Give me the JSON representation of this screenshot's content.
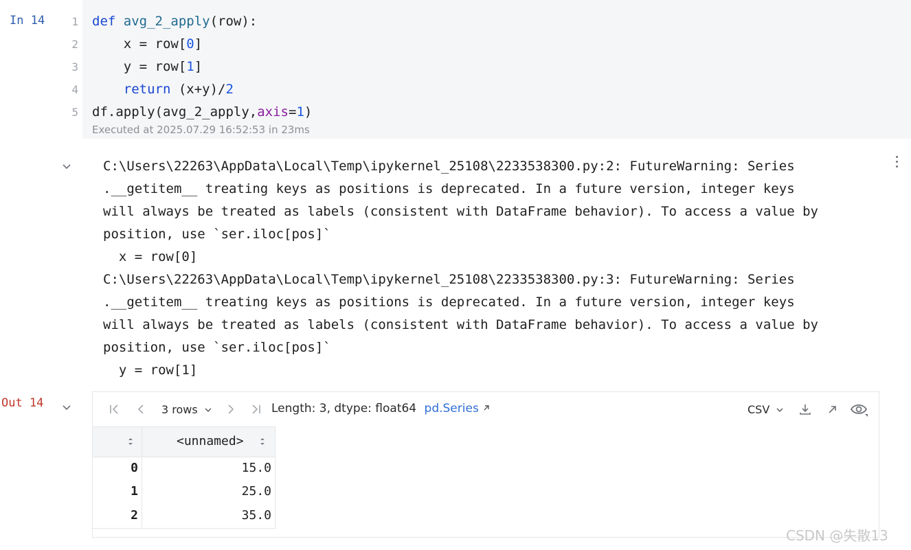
{
  "input_cell": {
    "prompt": "In 14",
    "line_numbers": [
      "1",
      "2",
      "3",
      "4",
      "5"
    ],
    "lines": [
      [
        {
          "t": "def ",
          "c": "kw"
        },
        {
          "t": "avg_2_apply",
          "c": "fn"
        },
        {
          "t": "(row):",
          "c": ""
        }
      ],
      [
        {
          "t": "    x = row[",
          "c": ""
        },
        {
          "t": "0",
          "c": "num"
        },
        {
          "t": "]",
          "c": ""
        }
      ],
      [
        {
          "t": "    y = row[",
          "c": ""
        },
        {
          "t": "1",
          "c": "num"
        },
        {
          "t": "]",
          "c": ""
        }
      ],
      [
        {
          "t": "    ",
          "c": ""
        },
        {
          "t": "return",
          "c": "kw"
        },
        {
          "t": " (x+y)/",
          "c": ""
        },
        {
          "t": "2",
          "c": "num"
        }
      ],
      [
        {
          "t": "df.apply(avg_2_apply,",
          "c": ""
        },
        {
          "t": "axis",
          "c": "prm"
        },
        {
          "t": "=",
          "c": ""
        },
        {
          "t": "1",
          "c": "num"
        },
        {
          "t": ")",
          "c": ""
        }
      ]
    ],
    "executed": "Executed at 2025.07.29 16:52:53 in 23ms"
  },
  "stderr": {
    "lines": [
      "C:\\Users\\22263\\AppData\\Local\\Temp\\ipykernel_25108\\2233538300.py:2: FutureWarning: Series",
      ".__getitem__ treating keys as positions is deprecated. In a future version, integer keys",
      "will always be treated as labels (consistent with DataFrame behavior). To access a value by",
      "position, use `ser.iloc[pos]`",
      "  x = row[0]",
      "C:\\Users\\22263\\AppData\\Local\\Temp\\ipykernel_25108\\2233538300.py:3: FutureWarning: Series",
      ".__getitem__ treating keys as positions is deprecated. In a future version, integer keys",
      "will always be treated as labels (consistent with DataFrame behavior). To access a value by",
      "position, use `ser.iloc[pos]`",
      "  y = row[1]"
    ]
  },
  "output": {
    "prompt": "Out 14",
    "toolbar": {
      "rows_label": "3 rows",
      "info": "Length: 3, dtype: float64",
      "link": "pd.Series",
      "csv_label": "CSV"
    },
    "table": {
      "column_header": "<unnamed>",
      "rows": [
        {
          "index": "0",
          "value": "15.0"
        },
        {
          "index": "1",
          "value": "25.0"
        },
        {
          "index": "2",
          "value": "35.0"
        }
      ]
    }
  },
  "watermark": "CSDN @失散13",
  "icons": {
    "first": "first-page-icon",
    "prev": "prev-page-icon",
    "next": "next-page-icon",
    "last": "last-page-icon",
    "download": "download-icon",
    "open": "open-external-icon",
    "eye": "eye-icon"
  }
}
